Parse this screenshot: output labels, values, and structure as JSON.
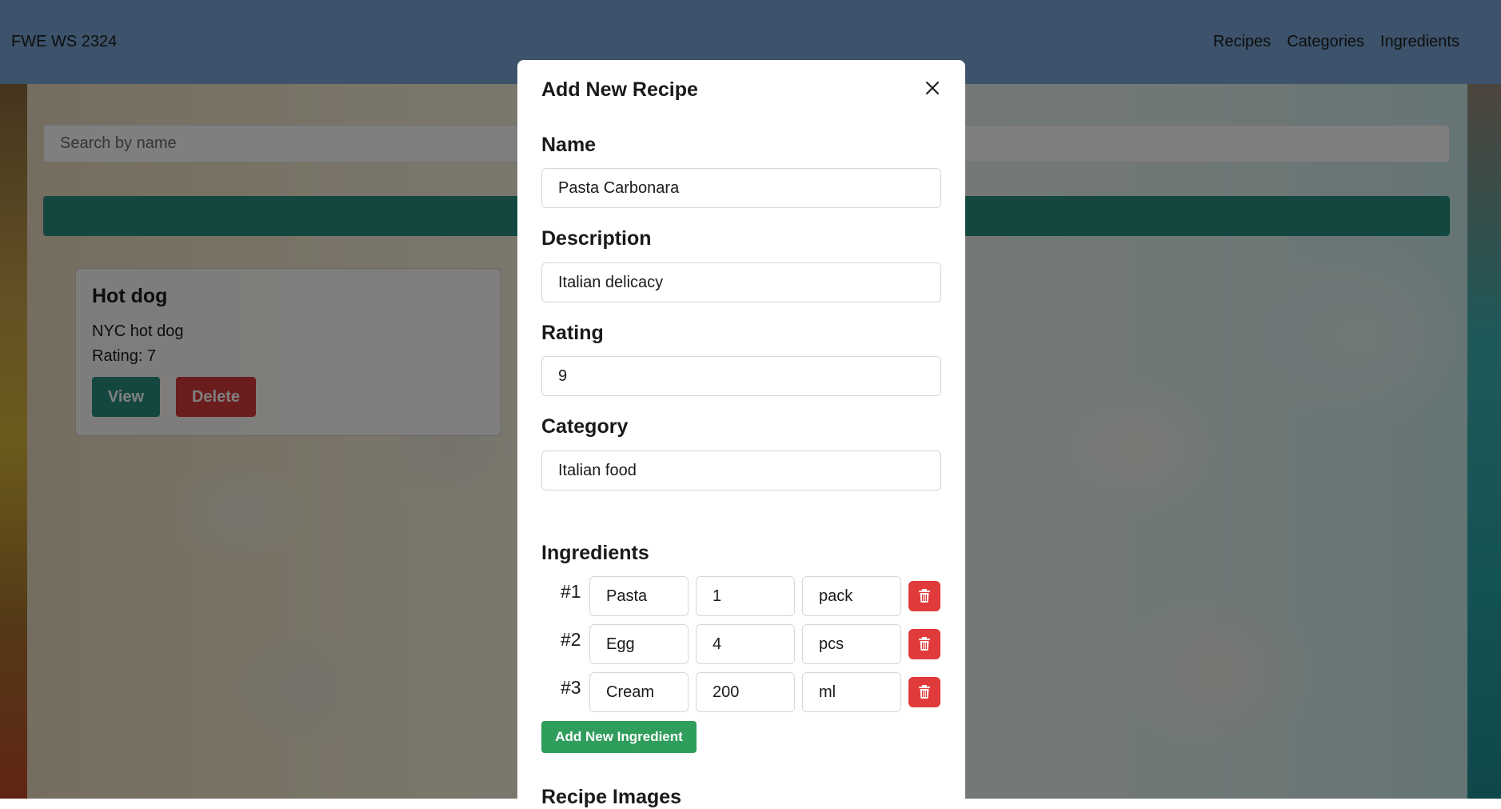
{
  "navbar": {
    "brand": "FWE WS 2324",
    "links": [
      "Recipes",
      "Categories",
      "Ingredients"
    ]
  },
  "main": {
    "search_placeholder": "Search by name",
    "recipe_cards": [
      {
        "title": "Hot dog",
        "description": "NYC hot dog",
        "rating_text": "Rating: 7",
        "view_label": "View",
        "delete_label": "Delete"
      }
    ]
  },
  "modal": {
    "title": "Add New Recipe",
    "fields": {
      "name": {
        "label": "Name",
        "value": "Pasta Carbonara"
      },
      "description": {
        "label": "Description",
        "value": "Italian delicacy"
      },
      "rating": {
        "label": "Rating",
        "value": "9"
      },
      "category": {
        "label": "Category",
        "value": "Italian food"
      }
    },
    "ingredients_label": "Ingredients",
    "ingredients": [
      {
        "num": "#1",
        "name": "Pasta",
        "quantity": "1",
        "unit": "pack"
      },
      {
        "num": "#2",
        "name": "Egg",
        "quantity": "4",
        "unit": "pcs"
      },
      {
        "num": "#3",
        "name": "Cream",
        "quantity": "200",
        "unit": "ml"
      }
    ],
    "add_ingredient_label": "Add New Ingredient",
    "images_label": "Recipe Images"
  },
  "colors": {
    "navbar": "#79a6d6",
    "primary_teal": "#2a8f83",
    "danger": "#d63b3b",
    "success": "#2f9d5b"
  },
  "icons": {
    "close": "close-icon",
    "delete": "trash-icon"
  }
}
